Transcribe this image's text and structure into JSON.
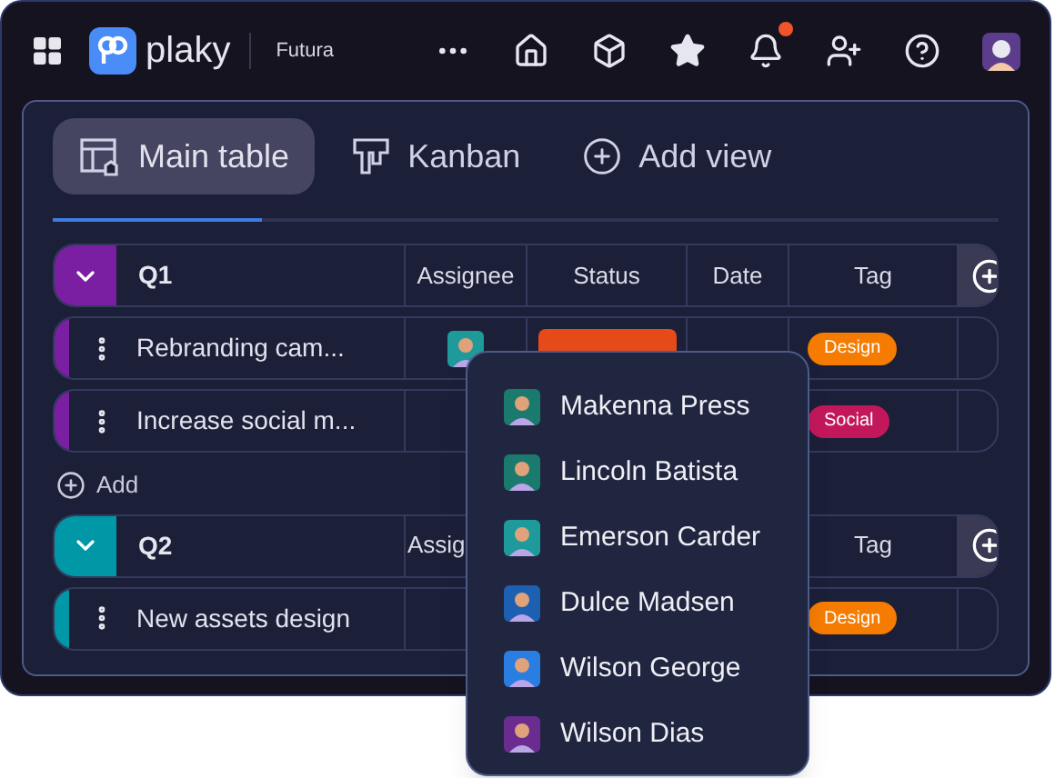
{
  "app": {
    "logo": "plaky",
    "workspace": "Futura",
    "notification": true
  },
  "views": [
    {
      "label": "Main table",
      "kind": "table",
      "selected": true
    },
    {
      "label": "Kanban",
      "kind": "kanban",
      "selected": false
    },
    {
      "label": "Add view",
      "kind": "add",
      "selected": false
    }
  ],
  "groups": [
    {
      "name": "Q1",
      "color": "#7b1fa2",
      "expanded": true,
      "columns": [
        {
          "kind": "assignee",
          "label": "Assignee"
        },
        {
          "kind": "status",
          "label": "Status"
        },
        {
          "kind": "date",
          "label": "Date"
        },
        {
          "kind": "tag",
          "label": "Tag"
        }
      ],
      "rows": [
        {
          "name": "Rebranding cam...",
          "assignee": {
            "color": "#1e9a9a"
          },
          "tag": {
            "label": "Design",
            "color": "#f57c00"
          }
        },
        {
          "name": "Increase social m...",
          "tag": {
            "label": "Social",
            "color": "#c2185b"
          }
        }
      ],
      "add_label": "Add"
    },
    {
      "name": "Q2",
      "color": "#0097a7",
      "expanded": true,
      "columns": [
        {
          "kind": "assignee",
          "label": "Assig"
        },
        {
          "kind": "tag",
          "label": "Tag"
        }
      ],
      "rows": [
        {
          "name": "New assets design",
          "tag": {
            "label": "Design",
            "color": "#f57c00"
          }
        }
      ]
    }
  ],
  "assignee_menu": {
    "people": [
      {
        "name": "Makenna Press",
        "color": "#1b7a6e"
      },
      {
        "name": "Lincoln Batista",
        "color": "#1b7a6e"
      },
      {
        "name": "Emerson Carder",
        "color": "#1e9a9a"
      },
      {
        "name": "Dulce Madsen",
        "color": "#1d5fb0"
      },
      {
        "name": "Wilson George",
        "color": "#2a7de1"
      },
      {
        "name": "Wilson Dias",
        "color": "#6a2d8f"
      }
    ]
  }
}
